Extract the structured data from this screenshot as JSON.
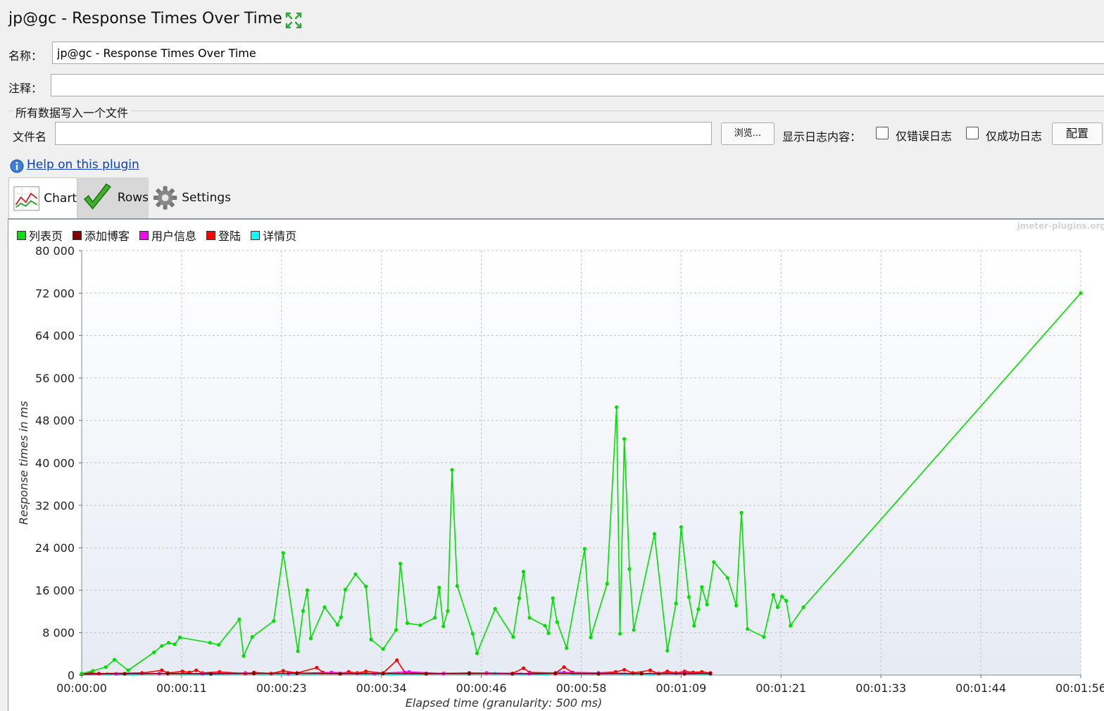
{
  "window": {
    "title": "jp@gc - Response Times Over Time"
  },
  "form": {
    "name_label": "名称：",
    "name_value": "jp@gc - Response Times Over Time",
    "comment_label": "注释：",
    "comment_value": "",
    "group_title": "所有数据写入一个文件",
    "file_label": "文件名",
    "file_value": "",
    "browse_label": "浏览...",
    "log_content_label": "显示日志内容：",
    "errors_only_label": "仅错误日志",
    "errors_only_checked": false,
    "success_only_label": "仅成功日志",
    "success_only_checked": false,
    "config_label": "配置"
  },
  "help": {
    "link_text": "Help on this plugin"
  },
  "tabs": [
    {
      "label": "Chart",
      "icon": "chart-icon"
    },
    {
      "label": "Rows",
      "icon": "checkmark-icon"
    },
    {
      "label": "Settings",
      "icon": "gear-icon"
    }
  ],
  "watermark": "jmeter-plugins.org",
  "chart_data": {
    "type": "line",
    "xlabel": "Elapsed time (granularity: 500 ms)",
    "ylabel": "Response times in ms",
    "ylim": [
      0,
      80000
    ],
    "xlim": [
      0,
      116
    ],
    "yticks": [
      "0",
      "8 000",
      "16 000",
      "24 000",
      "32 000",
      "40 000",
      "48 000",
      "56 000",
      "64 000",
      "72 000",
      "80 000"
    ],
    "xticks": [
      "00:00:00",
      "00:00:11",
      "00:00:23",
      "00:00:34",
      "00:00:46",
      "00:00:58",
      "00:01:09",
      "00:01:21",
      "00:01:33",
      "00:01:44",
      "00:01:56"
    ],
    "grid": true,
    "legend_position": "top-left",
    "series": [
      {
        "name": "列表页",
        "color": "#00e000",
        "points": [
          [
            0,
            300
          ],
          [
            1.3,
            800
          ],
          [
            2.8,
            1500
          ],
          [
            3.8,
            2900
          ],
          [
            5.4,
            900
          ],
          [
            8.4,
            4300
          ],
          [
            9.3,
            5500
          ],
          [
            10.1,
            6100
          ],
          [
            10.8,
            5800
          ],
          [
            11.4,
            7100
          ],
          [
            14.9,
            6100
          ],
          [
            15.9,
            5700
          ],
          [
            18.3,
            10500
          ],
          [
            18.8,
            3600
          ],
          [
            19.8,
            7200
          ],
          [
            22.3,
            10200
          ],
          [
            23.4,
            23000
          ],
          [
            25.1,
            4500
          ],
          [
            25.7,
            12100
          ],
          [
            26.2,
            16000
          ],
          [
            26.6,
            6900
          ],
          [
            28.2,
            12800
          ],
          [
            29.7,
            9500
          ],
          [
            30.1,
            10900
          ],
          [
            30.6,
            16100
          ],
          [
            31.8,
            19000
          ],
          [
            33.0,
            16700
          ],
          [
            33.6,
            6700
          ],
          [
            35.0,
            4900
          ],
          [
            36.5,
            8500
          ],
          [
            37.0,
            21000
          ],
          [
            37.8,
            9800
          ],
          [
            39.3,
            9400
          ],
          [
            41.0,
            10800
          ],
          [
            41.5,
            16500
          ],
          [
            42.0,
            9200
          ],
          [
            42.5,
            12100
          ],
          [
            43.0,
            38700
          ],
          [
            43.6,
            16800
          ],
          [
            45.4,
            7800
          ],
          [
            45.9,
            4100
          ],
          [
            48.0,
            12500
          ],
          [
            50.1,
            7200
          ],
          [
            50.8,
            14500
          ],
          [
            51.3,
            19500
          ],
          [
            52.0,
            10800
          ],
          [
            53.8,
            9300
          ],
          [
            54.2,
            7900
          ],
          [
            54.7,
            14500
          ],
          [
            55.2,
            10000
          ],
          [
            56.3,
            5100
          ],
          [
            58.4,
            23800
          ],
          [
            59.1,
            7100
          ],
          [
            61.0,
            17200
          ],
          [
            62.1,
            50500
          ],
          [
            62.5,
            7800
          ],
          [
            63.0,
            44500
          ],
          [
            63.6,
            20000
          ],
          [
            64.1,
            8500
          ],
          [
            66.5,
            26600
          ],
          [
            68.0,
            4600
          ],
          [
            69.0,
            13500
          ],
          [
            69.6,
            27900
          ],
          [
            70.5,
            14700
          ],
          [
            71.1,
            9300
          ],
          [
            71.6,
            12400
          ],
          [
            72.0,
            16600
          ],
          [
            72.6,
            13300
          ],
          [
            73.4,
            21300
          ],
          [
            75.0,
            18300
          ],
          [
            76.0,
            13100
          ],
          [
            76.6,
            30600
          ],
          [
            77.3,
            8700
          ],
          [
            79.2,
            7200
          ],
          [
            80.3,
            15100
          ],
          [
            80.8,
            12800
          ],
          [
            81.3,
            14800
          ],
          [
            81.8,
            14000
          ],
          [
            82.3,
            9300
          ],
          [
            83.8,
            12800
          ],
          [
            116,
            72000
          ]
        ]
      },
      {
        "name": "添加博客",
        "color": "#800000",
        "points": [
          [
            0,
            200
          ],
          [
            5,
            250
          ],
          [
            10,
            300
          ],
          [
            15,
            250
          ],
          [
            20,
            300
          ],
          [
            25,
            350
          ],
          [
            30,
            250
          ],
          [
            35,
            300
          ],
          [
            40,
            250
          ],
          [
            45,
            300
          ],
          [
            50,
            250
          ],
          [
            55,
            300
          ],
          [
            60,
            250
          ],
          [
            65,
            300
          ],
          [
            70,
            250
          ],
          [
            73,
            300
          ]
        ]
      },
      {
        "name": "用户信息",
        "color": "#ff00ff",
        "points": [
          [
            0,
            200
          ],
          [
            4,
            250
          ],
          [
            9,
            300
          ],
          [
            14,
            250
          ],
          [
            19,
            400
          ],
          [
            24,
            300
          ],
          [
            29,
            500
          ],
          [
            34,
            300
          ],
          [
            38,
            600
          ],
          [
            42,
            300
          ],
          [
            47,
            400
          ],
          [
            52,
            300
          ],
          [
            56,
            500
          ],
          [
            60,
            400
          ],
          [
            65,
            300
          ],
          [
            70,
            400
          ],
          [
            73,
            300
          ]
        ]
      },
      {
        "name": "登陆",
        "color": "#ff0000",
        "points": [
          [
            0,
            200
          ],
          [
            1,
            400
          ],
          [
            2,
            300
          ],
          [
            7,
            400
          ],
          [
            9.3,
            900
          ],
          [
            10,
            400
          ],
          [
            11.7,
            700
          ],
          [
            12.5,
            500
          ],
          [
            13.3,
            900
          ],
          [
            14,
            400
          ],
          [
            16,
            600
          ],
          [
            19,
            300
          ],
          [
            20,
            500
          ],
          [
            22,
            300
          ],
          [
            23.4,
            800
          ],
          [
            25,
            400
          ],
          [
            27.3,
            1400
          ],
          [
            28,
            500
          ],
          [
            30,
            300
          ],
          [
            31,
            600
          ],
          [
            32,
            400
          ],
          [
            33,
            700
          ],
          [
            35,
            400
          ],
          [
            36.6,
            2800
          ],
          [
            37.5,
            500
          ],
          [
            40,
            300
          ],
          [
            45,
            400
          ],
          [
            50,
            300
          ],
          [
            51.3,
            1300
          ],
          [
            52,
            500
          ],
          [
            55,
            400
          ],
          [
            56,
            1500
          ],
          [
            57,
            500
          ],
          [
            60,
            400
          ],
          [
            62,
            600
          ],
          [
            63,
            1000
          ],
          [
            64,
            400
          ],
          [
            66,
            900
          ],
          [
            67,
            300
          ],
          [
            68,
            700
          ],
          [
            69,
            400
          ],
          [
            70,
            700
          ],
          [
            71,
            500
          ],
          [
            72,
            600
          ],
          [
            73,
            400
          ]
        ]
      },
      {
        "name": "详情页",
        "color": "#00ffff",
        "points": [
          [
            0,
            150
          ],
          [
            3,
            200
          ],
          [
            6,
            150
          ],
          [
            9,
            250
          ],
          [
            12,
            200
          ],
          [
            15,
            150
          ],
          [
            18,
            250
          ],
          [
            21,
            200
          ],
          [
            24,
            150
          ],
          [
            27,
            200
          ],
          [
            30,
            300
          ],
          [
            33,
            200
          ],
          [
            36,
            150
          ],
          [
            39,
            200
          ],
          [
            42,
            250
          ],
          [
            45,
            200
          ],
          [
            48,
            300
          ],
          [
            51,
            200
          ],
          [
            54,
            150
          ],
          [
            55.5,
            600
          ],
          [
            57,
            200
          ],
          [
            60,
            250
          ],
          [
            63,
            200
          ],
          [
            66,
            150
          ],
          [
            69,
            250
          ],
          [
            72,
            200
          ],
          [
            73,
            150
          ]
        ]
      }
    ]
  }
}
